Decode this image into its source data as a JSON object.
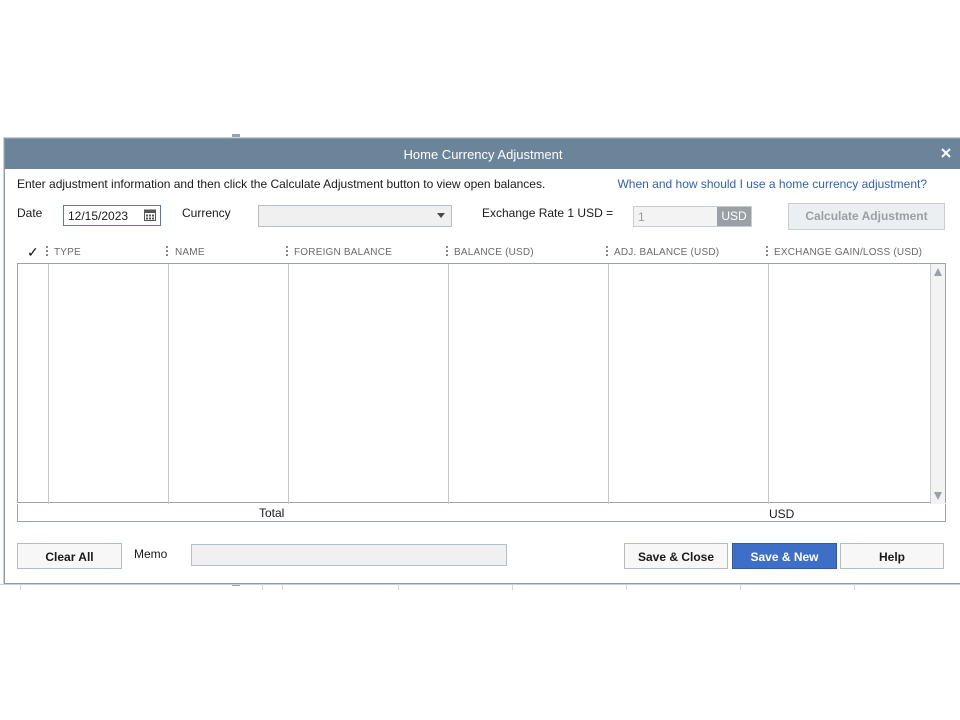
{
  "dialog": {
    "title": "Home Currency Adjustment",
    "instructions": "Enter adjustment information and then click the Calculate Adjustment button to view open balances.",
    "help_link": "When and how should I use a home currency adjustment?"
  },
  "form": {
    "date_label": "Date",
    "date_value": "12/15/2023",
    "currency_label": "Currency",
    "currency_value": "",
    "exchange_rate_label": "Exchange Rate 1 USD =",
    "exchange_rate_value": "1",
    "exchange_rate_unit": "USD",
    "calculate_button": "Calculate Adjustment"
  },
  "table": {
    "check_header": "✓",
    "columns": [
      "TYPE",
      "NAME",
      "FOREIGN BALANCE",
      "BALANCE (USD)",
      "ADJ. BALANCE (USD)",
      "EXCHANGE GAIN/LOSS (USD)"
    ],
    "rows": [],
    "total_label": "Total",
    "total_unit": "USD"
  },
  "footer": {
    "clear_all": "Clear All",
    "memo_label": "Memo",
    "memo_value": "",
    "save_close": "Save & Close",
    "save_new": "Save & New",
    "help": "Help"
  },
  "colors": {
    "titlebar": "#6b8499",
    "primary_button": "#3d6fc9",
    "link": "#2f62b5"
  }
}
